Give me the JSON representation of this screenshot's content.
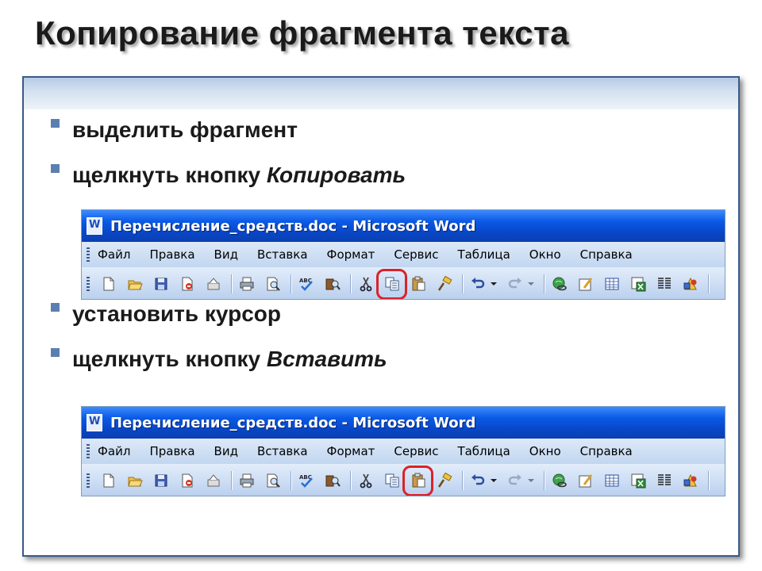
{
  "slide": {
    "title": "Копирование фрагмента текста",
    "bullets": [
      {
        "text": "выделить фрагмент",
        "em": ""
      },
      {
        "text": "щелкнуть кнопку ",
        "em": "Копировать"
      },
      {
        "text": "установить курсор",
        "em": ""
      },
      {
        "text": "щелкнуть кнопку ",
        "em": "Вставить"
      }
    ],
    "bullet_color": "#5b7fb0",
    "highlight_color": "#d9232a"
  },
  "word_windows": [
    {
      "title": "Перечисление_средств.doc - Microsoft Word",
      "menu": [
        "Файл",
        "Правка",
        "Вид",
        "Вставка",
        "Формат",
        "Сервис",
        "Таблица",
        "Окно",
        "Справка"
      ],
      "highlighted_button": "copy"
    },
    {
      "title": "Перечисление_средств.doc - Microsoft Word",
      "menu": [
        "Файл",
        "Правка",
        "Вид",
        "Вставка",
        "Формат",
        "Сервис",
        "Таблица",
        "Окно",
        "Справка"
      ],
      "highlighted_button": "paste"
    }
  ],
  "toolbar_icons": [
    "new-document-icon",
    "open-folder-icon",
    "save-icon",
    "permission-icon",
    "email-icon",
    "print-icon",
    "print-preview-icon",
    "spelling-icon",
    "research-icon",
    "cut-icon",
    "copy-icon",
    "paste-icon",
    "format-painter-icon",
    "undo-icon",
    "redo-icon",
    "hyperlink-icon",
    "tables-borders-icon",
    "insert-table-icon",
    "insert-excel-icon",
    "columns-icon",
    "drawing-icon"
  ]
}
